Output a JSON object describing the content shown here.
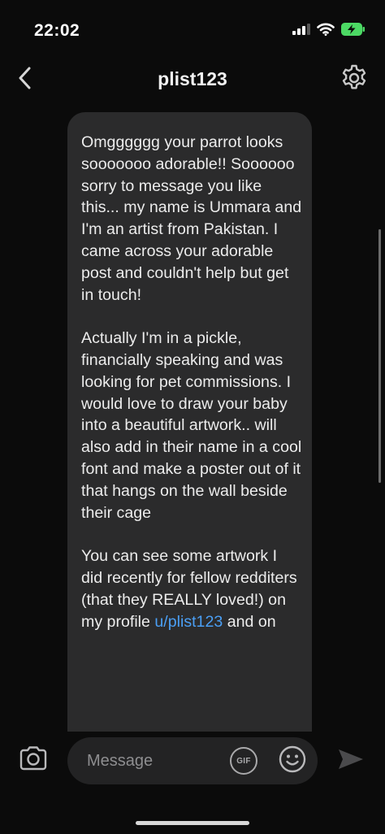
{
  "status_bar": {
    "time": "22:02",
    "icons": [
      "cellular-signal-icon",
      "wifi-icon",
      "battery-charging-icon"
    ],
    "battery_color": "#4cd964"
  },
  "header": {
    "title": "plist123",
    "back_icon": "chevron-left-icon",
    "settings_icon": "gear-icon"
  },
  "message": {
    "paragraphs": [
      "Omgggggg your parrot looks sooooooo adorable!! Soooooo sorry to message you like this... my name is Ummara and I'm an artist from Pakistan. I came across your adorable post and couldn't help but get in touch!",
      "Actually I'm in a pickle, financially speaking and was looking for pet commissions. I would love to draw your baby into a beautiful artwork.. will also add in their name in a cool font and make a poster out of it that hangs on the wall beside their cage"
    ],
    "paragraph3_before_link": "You can see some artwork I did recently for fellow redditers (that they REALLY loved!) on my profile ",
    "profile_link": "u/plist123",
    "paragraph3_after_link": " and on",
    "link_color": "#4a9ff5",
    "bubble_color": "#2b2b2c"
  },
  "composer": {
    "placeholder": "Message",
    "gif_label": "GIF",
    "camera_icon": "camera-icon",
    "emoji_icon": "smiley-face-icon",
    "send_icon": "send-arrow-icon"
  },
  "colors": {
    "background": "#0b0b0b",
    "text": "#ececec"
  }
}
